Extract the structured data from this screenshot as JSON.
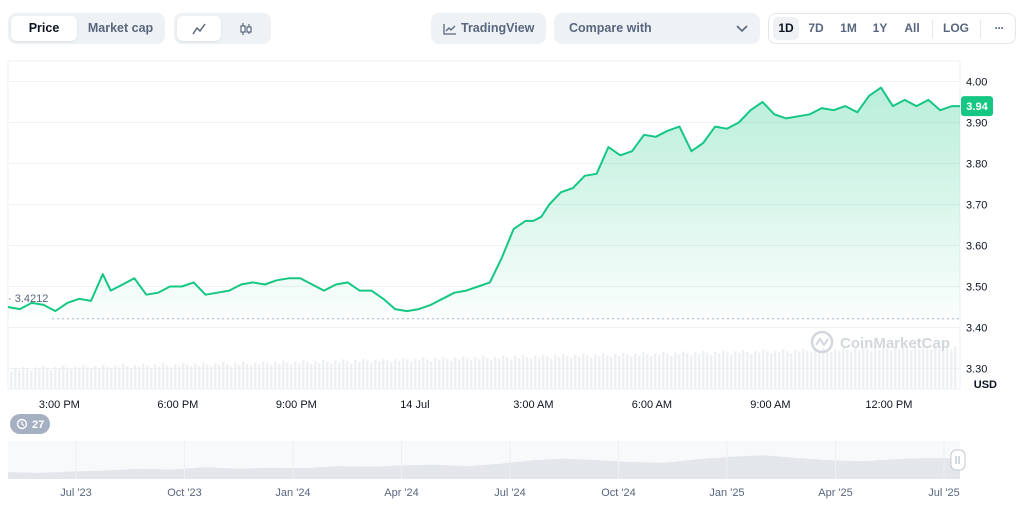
{
  "toolbar": {
    "view_tabs": [
      "Price",
      "Market cap"
    ],
    "active_view": "Price",
    "chart_type_icons": [
      "line-chart-icon",
      "candlestick-icon"
    ],
    "tradingview_label": "TradingView",
    "compare_label": "Compare with",
    "ranges": [
      "1D",
      "7D",
      "1M",
      "1Y",
      "All",
      "LOG"
    ],
    "active_range": "1D",
    "more_label": "···"
  },
  "colors": {
    "accent": "#16c784",
    "line": "#16c784",
    "badge": "#16c784"
  },
  "watermark": "CoinMarketCap",
  "history_badge": "27",
  "chart_data": {
    "type": "area",
    "title": "",
    "xlabel": "",
    "ylabel": "USD",
    "ylim": [
      3.25,
      4.05
    ],
    "y_ticks": [
      "4.00",
      "3.90",
      "3.80",
      "3.70",
      "3.60",
      "3.50",
      "3.40",
      "3.30"
    ],
    "x_ticks": [
      "3:00 PM",
      "6:00 PM",
      "9:00 PM",
      "14 Jul",
      "3:00 AM",
      "6:00 AM",
      "9:00 AM",
      "12:00 PM"
    ],
    "x_tick_hours": [
      3,
      6,
      9,
      12,
      15,
      18,
      21,
      24
    ],
    "x_range_hours": [
      1.7,
      25.8
    ],
    "open_price": 3.4212,
    "open_price_label": "3.4212",
    "current_price": 3.94,
    "current_price_label": "3.94",
    "grid": true,
    "series": [
      {
        "x": [
          1.7,
          2.0,
          2.3,
          2.6,
          2.9,
          3.2,
          3.5,
          3.8,
          4.1,
          4.3,
          4.6,
          4.9,
          5.2,
          5.5,
          5.8,
          6.1,
          6.4,
          6.7,
          7.0,
          7.3,
          7.6,
          7.9,
          8.2,
          8.5,
          8.8,
          9.1,
          9.4,
          9.7,
          10.0,
          10.3,
          10.6,
          10.9,
          11.2,
          11.5,
          11.8,
          12.1,
          12.4,
          12.7,
          13.0,
          13.3,
          13.6,
          13.9,
          14.2,
          14.5,
          14.8,
          15.0,
          15.2,
          15.4,
          15.7,
          16.0,
          16.3,
          16.6,
          16.9,
          17.2,
          17.5,
          17.8,
          18.1,
          18.4,
          18.7,
          19.0,
          19.3,
          19.6,
          19.9,
          20.2,
          20.5,
          20.8,
          21.1,
          21.4,
          21.7,
          22.0,
          22.3,
          22.6,
          22.9,
          23.2,
          23.5,
          23.8,
          24.1,
          24.4,
          24.7,
          25.0,
          25.3,
          25.6,
          25.8
        ],
        "values": [
          3.45,
          3.445,
          3.46,
          3.455,
          3.44,
          3.46,
          3.47,
          3.465,
          3.53,
          3.49,
          3.505,
          3.52,
          3.48,
          3.485,
          3.5,
          3.5,
          3.51,
          3.48,
          3.485,
          3.49,
          3.505,
          3.51,
          3.505,
          3.515,
          3.52,
          3.52,
          3.505,
          3.49,
          3.505,
          3.51,
          3.49,
          3.49,
          3.47,
          3.445,
          3.44,
          3.445,
          3.455,
          3.47,
          3.485,
          3.49,
          3.5,
          3.51,
          3.57,
          3.64,
          3.66,
          3.66,
          3.67,
          3.7,
          3.73,
          3.74,
          3.77,
          3.775,
          3.84,
          3.82,
          3.83,
          3.87,
          3.865,
          3.88,
          3.89,
          3.83,
          3.85,
          3.89,
          3.885,
          3.9,
          3.93,
          3.95,
          3.92,
          3.91,
          3.915,
          3.92,
          3.935,
          3.93,
          3.94,
          3.925,
          3.965,
          3.985,
          3.94,
          3.955,
          3.94,
          3.955,
          3.93,
          3.94,
          3.94
        ]
      }
    ]
  },
  "navigator": {
    "x_ticks": [
      "Jul '23",
      "Oct '23",
      "Jan '24",
      "Apr '24",
      "Jul '24",
      "Oct '24",
      "Jan '25",
      "Apr '25",
      "Jul '25"
    ],
    "handle_icon": "drag-handle-icon"
  }
}
